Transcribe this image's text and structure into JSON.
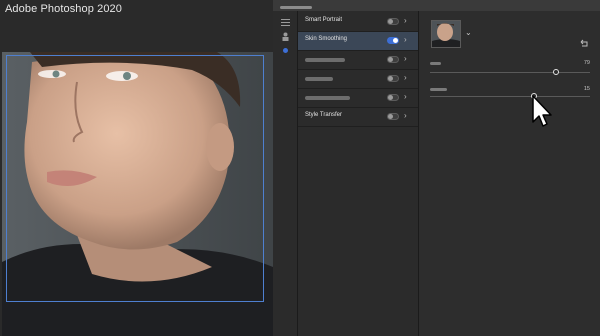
{
  "app": {
    "title": "Adobe Photoshop 2020"
  },
  "filters": [
    {
      "label": "Smart Portrait",
      "enabled": false,
      "active": false
    },
    {
      "label": "Skin Smoothing",
      "enabled": true,
      "active": true
    },
    {
      "label": "",
      "enabled": false,
      "active": false
    },
    {
      "label": "",
      "enabled": false,
      "active": false
    },
    {
      "label": "",
      "enabled": false,
      "active": false
    },
    {
      "label": "Style Transfer",
      "enabled": false,
      "active": false
    }
  ],
  "sliders": [
    {
      "value": "79",
      "level": 0.79
    },
    {
      "value": "15",
      "level": 0.65
    }
  ],
  "icons": {
    "reset": "reset-icon",
    "dropdown": "chevron-down-icon",
    "cursor": "mouse-pointer-icon"
  },
  "colors": {
    "accent": "#3d6fd6",
    "selection": "#4e7fd0"
  }
}
